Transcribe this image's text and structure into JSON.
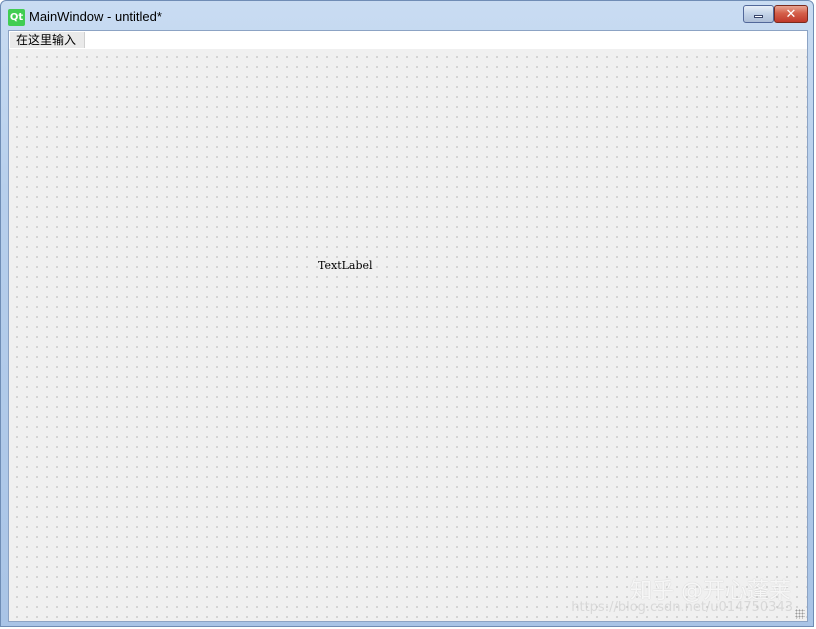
{
  "window": {
    "title": "MainWindow - untitled*",
    "icon": "qt-logo-icon",
    "icon_text": "Qt",
    "minimize_icon": "minimize-icon",
    "close_icon": "close-icon",
    "close_glyph": "✕"
  },
  "menubar": {
    "placeholder_item": "在这里输入"
  },
  "form": {
    "text_label": "TextLabel"
  },
  "watermark": {
    "text": "知乎 @开心蓬莱",
    "url": "https://blog.csdn.net/u014750343"
  },
  "colors": {
    "qt_green": "#41cd52",
    "titlebar": "#b7cfec",
    "close_button": "#c0392b",
    "canvas": "#f0f0f0"
  }
}
